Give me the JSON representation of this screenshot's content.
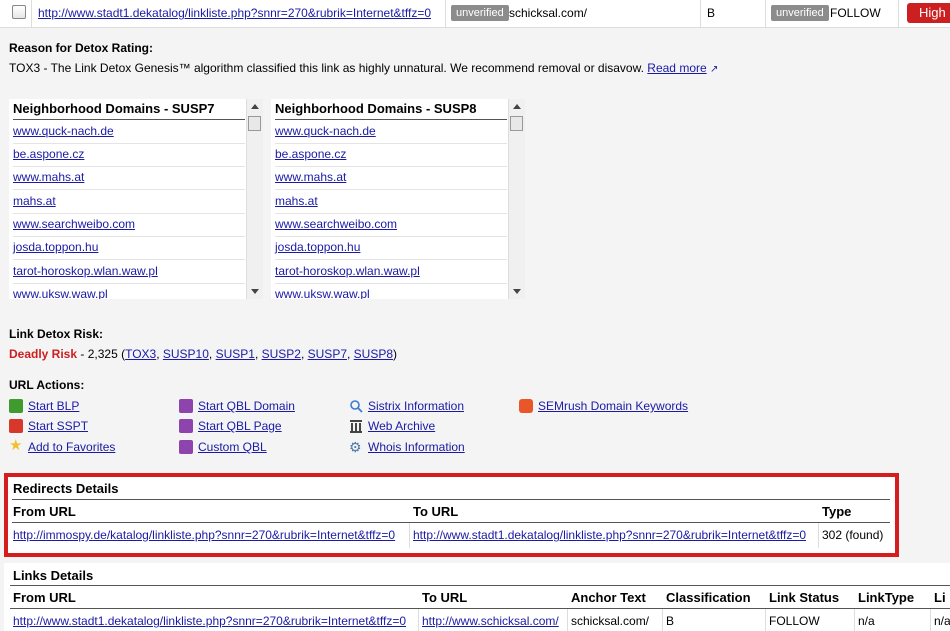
{
  "top_row": {
    "url": "http://www.stadt1.dekatalog/linkliste.php?snnr=270&rubrik=Internet&tffz=0",
    "badge1": "unverified",
    "domain": "schicksal.com/",
    "class": "B",
    "badge2": "unverified",
    "status": "FOLLOW",
    "risk": "High"
  },
  "reason": {
    "title": "Reason for Detox Rating:",
    "text": "TOX3 - The Link Detox Genesis™ algorithm classified this link as highly unnatural. We recommend removal or disavow.",
    "read_more": "Read more"
  },
  "neighborhood": [
    {
      "title": "Neighborhood Domains - SUSP7",
      "items": [
        "www.quck-nach.de",
        "be.aspone.cz",
        "www.mahs.at",
        "mahs.at",
        "www.searchweibo.com",
        "josda.toppon.hu",
        "tarot-horoskop.wlan.waw.pl",
        "www.uksw.waw.pl"
      ]
    },
    {
      "title": "Neighborhood Domains - SUSP8",
      "items": [
        "www.quck-nach.de",
        "be.aspone.cz",
        "www.mahs.at",
        "mahs.at",
        "www.searchweibo.com",
        "josda.toppon.hu",
        "tarot-horoskop.wlan.waw.pl",
        "www.uksw.waw.pl"
      ]
    }
  ],
  "risk": {
    "title": "Link Detox Risk:",
    "level": "Deadly Risk",
    "score_text": " - 2,325 (",
    "tags": [
      "TOX3",
      "SUSP10",
      "SUSP1",
      "SUSP2",
      "SUSP7",
      "SUSP8"
    ],
    "close": ")"
  },
  "actions": {
    "title": "URL Actions:",
    "items": [
      {
        "label": "Start BLP",
        "icon": "blp-icon",
        "color": "#3f9b2e"
      },
      {
        "label": "Start SSPT",
        "icon": "sspt-icon",
        "color": "#d8382b"
      },
      {
        "label": "Add to Favorites",
        "icon": "star-icon",
        "color": "#f2c12e"
      },
      {
        "label": "Start QBL Domain",
        "icon": "qbl-icon",
        "color": "#8e44ad"
      },
      {
        "label": "Start QBL Page",
        "icon": "qbl-icon",
        "color": "#8e44ad"
      },
      {
        "label": "Custom QBL",
        "icon": "qbl-icon",
        "color": "#8e44ad"
      },
      {
        "label": "Sistrix Information",
        "icon": "magnifier-icon",
        "color": "#3a7bd5"
      },
      {
        "label": "Web Archive",
        "icon": "archive-icon",
        "color": "#444444"
      },
      {
        "label": "Whois Information",
        "icon": "gear-icon",
        "color": "#4a78a8"
      },
      {
        "label": "SEMrush Domain Keywords",
        "icon": "semrush-icon",
        "color": "#e8562a"
      }
    ]
  },
  "redirects": {
    "title": "Redirects Details",
    "headers": [
      "From URL",
      "To URL",
      "Type"
    ],
    "row": [
      "http://immospy.de/katalog/linkliste.php?snnr=270&rubrik=Internet&tffz=0",
      "http://www.stadt1.dekatalog/linkliste.php?snnr=270&rubrik=Internet&tffz=0",
      "302 (found)"
    ]
  },
  "links": {
    "title": "Links Details",
    "headers": [
      "From URL",
      "To URL",
      "Anchor Text",
      "Classification",
      "Link Status",
      "LinkType",
      "Li"
    ],
    "row": [
      "http://www.stadt1.dekatalog/linkliste.php?snnr=270&rubrik=Internet&tffz=0",
      "http://www.schicksal.com/",
      "schicksal.com/",
      "B",
      "FOLLOW",
      "n/a",
      "n/a"
    ]
  },
  "colors": {
    "accent_red": "#d51d1d",
    "link": "#1a1aa6",
    "risk_high": "#cc1f1f",
    "deadly": "#cc1f1f"
  }
}
